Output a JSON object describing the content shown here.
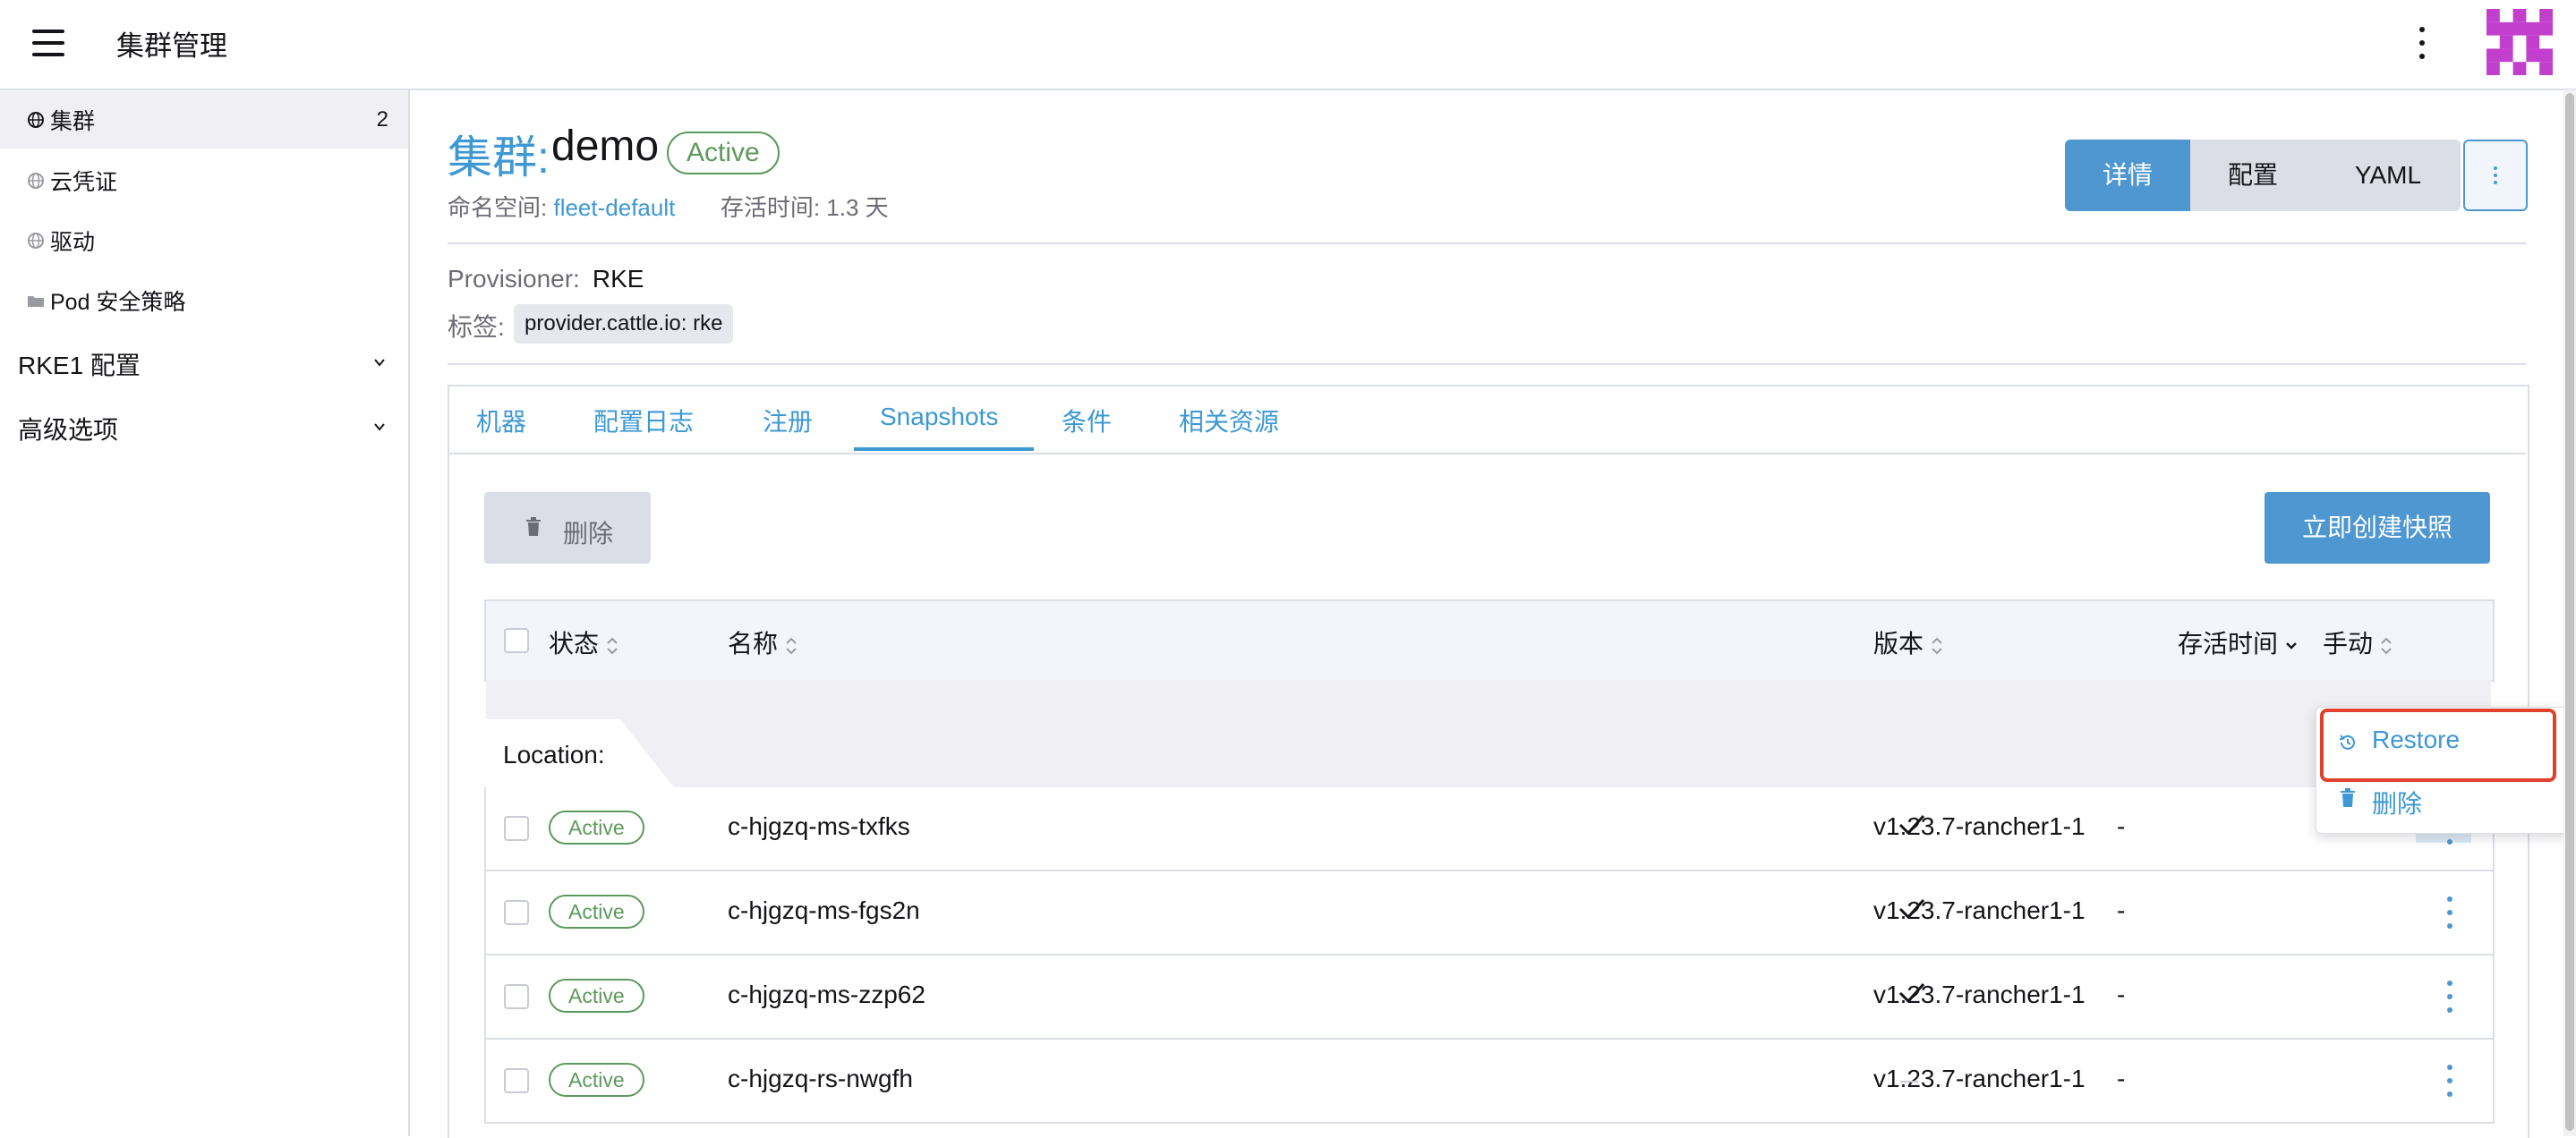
{
  "header": {
    "app_title": "集群管理",
    "menu_icon": "hamburger-icon",
    "more_icon": "vertical-ellipsis-icon",
    "avatar_icon": "user-identicon"
  },
  "sidebar": {
    "items": [
      {
        "label": "集群",
        "count": "2",
        "icon": "globe-icon",
        "active": true
      },
      {
        "label": "云凭证",
        "icon": "globe-icon"
      },
      {
        "label": "驱动",
        "icon": "globe-icon"
      },
      {
        "label": "Pod 安全策略",
        "icon": "folder-icon"
      }
    ],
    "groups": [
      {
        "label": "RKE1 配置"
      },
      {
        "label": "高级选项"
      }
    ]
  },
  "page": {
    "title_prefix": "集群:",
    "title_name": "demo",
    "status": "Active",
    "namespace_label": "命名空间:",
    "namespace_value": "fleet-default",
    "age_label": "存活时间:",
    "age_value": "1.3 天",
    "view_buttons": [
      "详情",
      "配置",
      "YAML"
    ],
    "provisioner_label": "Provisioner:",
    "provisioner_value": "RKE",
    "labels_label": "标签:",
    "label_chip": "provider.cattle.io: rke"
  },
  "tabs": [
    "机器",
    "配置日志",
    "注册",
    "Snapshots",
    "条件",
    "相关资源"
  ],
  "active_tab": "Snapshots",
  "actions": {
    "delete_label": "删除",
    "create_snapshot_label": "立即创建快照"
  },
  "table": {
    "columns": [
      "状态",
      "名称",
      "版本",
      "存活时间",
      "手动"
    ],
    "group_label": "Location:",
    "rows": [
      {
        "status": "Active",
        "name": "c-hjgzq-ms-txfks",
        "version": "v1.23.7-rancher1-1",
        "age": "-",
        "manual": true
      },
      {
        "status": "Active",
        "name": "c-hjgzq-ms-fgs2n",
        "version": "v1.23.7-rancher1-1",
        "age": "-",
        "manual": true
      },
      {
        "status": "Active",
        "name": "c-hjgzq-ms-zzp62",
        "version": "v1.23.7-rancher1-1",
        "age": "-",
        "manual": true
      },
      {
        "status": "Active",
        "name": "c-hjgzq-rs-nwgfh",
        "version": "v1.23.7-rancher1-1",
        "age": "-",
        "manual": false
      }
    ]
  },
  "context_menu": {
    "items": [
      {
        "label": "Restore",
        "icon": "restore-history-icon"
      },
      {
        "label": "删除",
        "icon": "trash-icon"
      }
    ],
    "highlight_color": "#e0412b"
  },
  "colors": {
    "accent": "#3d98d3",
    "primary_button": "#4f97d0",
    "success": "#5d995d"
  }
}
